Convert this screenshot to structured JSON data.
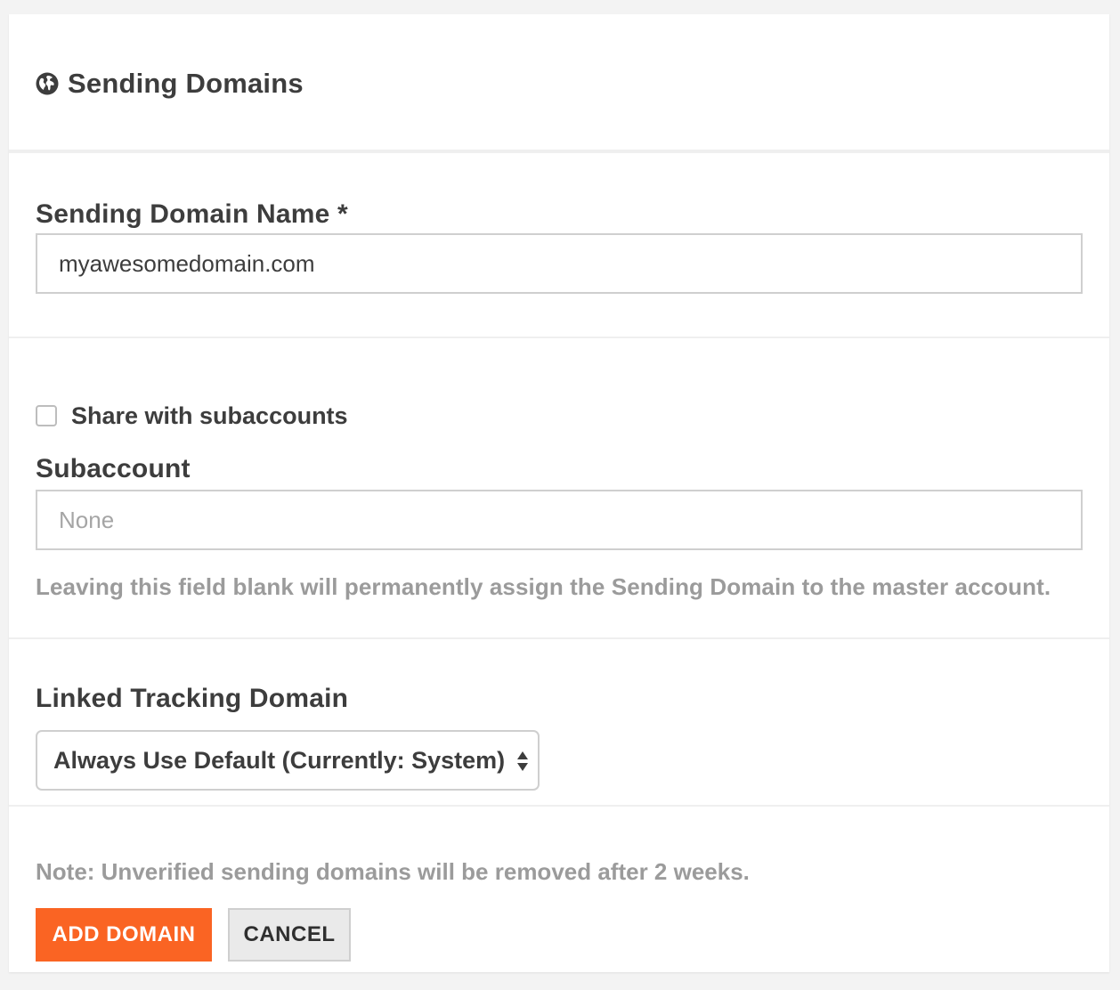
{
  "header": {
    "title": "Sending Domains",
    "icon": "globe-icon"
  },
  "domain_name": {
    "label": "Sending Domain Name *",
    "value": "myawesomedomain.com"
  },
  "subaccount": {
    "share_label": "Share with subaccounts",
    "share_checked": false,
    "label": "Subaccount",
    "placeholder": "None",
    "value": "",
    "help": "Leaving this field blank will permanently assign the Sending Domain to the master account."
  },
  "tracking": {
    "label": "Linked Tracking Domain",
    "selected": "Always Use Default (Currently: System)"
  },
  "footer": {
    "note": "Note: Unverified sending domains will be removed after 2 weeks.",
    "add_label": "ADD DOMAIN",
    "cancel_label": "CANCEL"
  },
  "colors": {
    "accent": "#fa6423",
    "text": "#3d3d3d",
    "muted": "#9b9b9b",
    "border": "#cfcfcf"
  }
}
